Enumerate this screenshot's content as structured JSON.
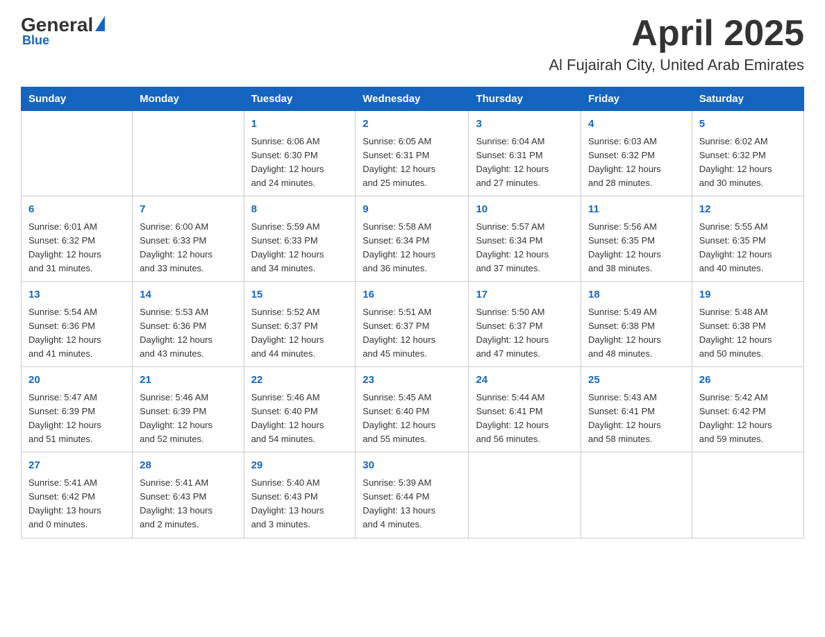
{
  "header": {
    "logo_general": "General",
    "logo_blue": "Blue",
    "month_year": "April 2025",
    "location": "Al Fujairah City, United Arab Emirates"
  },
  "weekdays": [
    "Sunday",
    "Monday",
    "Tuesday",
    "Wednesday",
    "Thursday",
    "Friday",
    "Saturday"
  ],
  "weeks": [
    [
      {
        "day": "",
        "info": ""
      },
      {
        "day": "",
        "info": ""
      },
      {
        "day": "1",
        "info": "Sunrise: 6:06 AM\nSunset: 6:30 PM\nDaylight: 12 hours\nand 24 minutes."
      },
      {
        "day": "2",
        "info": "Sunrise: 6:05 AM\nSunset: 6:31 PM\nDaylight: 12 hours\nand 25 minutes."
      },
      {
        "day": "3",
        "info": "Sunrise: 6:04 AM\nSunset: 6:31 PM\nDaylight: 12 hours\nand 27 minutes."
      },
      {
        "day": "4",
        "info": "Sunrise: 6:03 AM\nSunset: 6:32 PM\nDaylight: 12 hours\nand 28 minutes."
      },
      {
        "day": "5",
        "info": "Sunrise: 6:02 AM\nSunset: 6:32 PM\nDaylight: 12 hours\nand 30 minutes."
      }
    ],
    [
      {
        "day": "6",
        "info": "Sunrise: 6:01 AM\nSunset: 6:32 PM\nDaylight: 12 hours\nand 31 minutes."
      },
      {
        "day": "7",
        "info": "Sunrise: 6:00 AM\nSunset: 6:33 PM\nDaylight: 12 hours\nand 33 minutes."
      },
      {
        "day": "8",
        "info": "Sunrise: 5:59 AM\nSunset: 6:33 PM\nDaylight: 12 hours\nand 34 minutes."
      },
      {
        "day": "9",
        "info": "Sunrise: 5:58 AM\nSunset: 6:34 PM\nDaylight: 12 hours\nand 36 minutes."
      },
      {
        "day": "10",
        "info": "Sunrise: 5:57 AM\nSunset: 6:34 PM\nDaylight: 12 hours\nand 37 minutes."
      },
      {
        "day": "11",
        "info": "Sunrise: 5:56 AM\nSunset: 6:35 PM\nDaylight: 12 hours\nand 38 minutes."
      },
      {
        "day": "12",
        "info": "Sunrise: 5:55 AM\nSunset: 6:35 PM\nDaylight: 12 hours\nand 40 minutes."
      }
    ],
    [
      {
        "day": "13",
        "info": "Sunrise: 5:54 AM\nSunset: 6:36 PM\nDaylight: 12 hours\nand 41 minutes."
      },
      {
        "day": "14",
        "info": "Sunrise: 5:53 AM\nSunset: 6:36 PM\nDaylight: 12 hours\nand 43 minutes."
      },
      {
        "day": "15",
        "info": "Sunrise: 5:52 AM\nSunset: 6:37 PM\nDaylight: 12 hours\nand 44 minutes."
      },
      {
        "day": "16",
        "info": "Sunrise: 5:51 AM\nSunset: 6:37 PM\nDaylight: 12 hours\nand 45 minutes."
      },
      {
        "day": "17",
        "info": "Sunrise: 5:50 AM\nSunset: 6:37 PM\nDaylight: 12 hours\nand 47 minutes."
      },
      {
        "day": "18",
        "info": "Sunrise: 5:49 AM\nSunset: 6:38 PM\nDaylight: 12 hours\nand 48 minutes."
      },
      {
        "day": "19",
        "info": "Sunrise: 5:48 AM\nSunset: 6:38 PM\nDaylight: 12 hours\nand 50 minutes."
      }
    ],
    [
      {
        "day": "20",
        "info": "Sunrise: 5:47 AM\nSunset: 6:39 PM\nDaylight: 12 hours\nand 51 minutes."
      },
      {
        "day": "21",
        "info": "Sunrise: 5:46 AM\nSunset: 6:39 PM\nDaylight: 12 hours\nand 52 minutes."
      },
      {
        "day": "22",
        "info": "Sunrise: 5:46 AM\nSunset: 6:40 PM\nDaylight: 12 hours\nand 54 minutes."
      },
      {
        "day": "23",
        "info": "Sunrise: 5:45 AM\nSunset: 6:40 PM\nDaylight: 12 hours\nand 55 minutes."
      },
      {
        "day": "24",
        "info": "Sunrise: 5:44 AM\nSunset: 6:41 PM\nDaylight: 12 hours\nand 56 minutes."
      },
      {
        "day": "25",
        "info": "Sunrise: 5:43 AM\nSunset: 6:41 PM\nDaylight: 12 hours\nand 58 minutes."
      },
      {
        "day": "26",
        "info": "Sunrise: 5:42 AM\nSunset: 6:42 PM\nDaylight: 12 hours\nand 59 minutes."
      }
    ],
    [
      {
        "day": "27",
        "info": "Sunrise: 5:41 AM\nSunset: 6:42 PM\nDaylight: 13 hours\nand 0 minutes."
      },
      {
        "day": "28",
        "info": "Sunrise: 5:41 AM\nSunset: 6:43 PM\nDaylight: 13 hours\nand 2 minutes."
      },
      {
        "day": "29",
        "info": "Sunrise: 5:40 AM\nSunset: 6:43 PM\nDaylight: 13 hours\nand 3 minutes."
      },
      {
        "day": "30",
        "info": "Sunrise: 5:39 AM\nSunset: 6:44 PM\nDaylight: 13 hours\nand 4 minutes."
      },
      {
        "day": "",
        "info": ""
      },
      {
        "day": "",
        "info": ""
      },
      {
        "day": "",
        "info": ""
      }
    ]
  ]
}
